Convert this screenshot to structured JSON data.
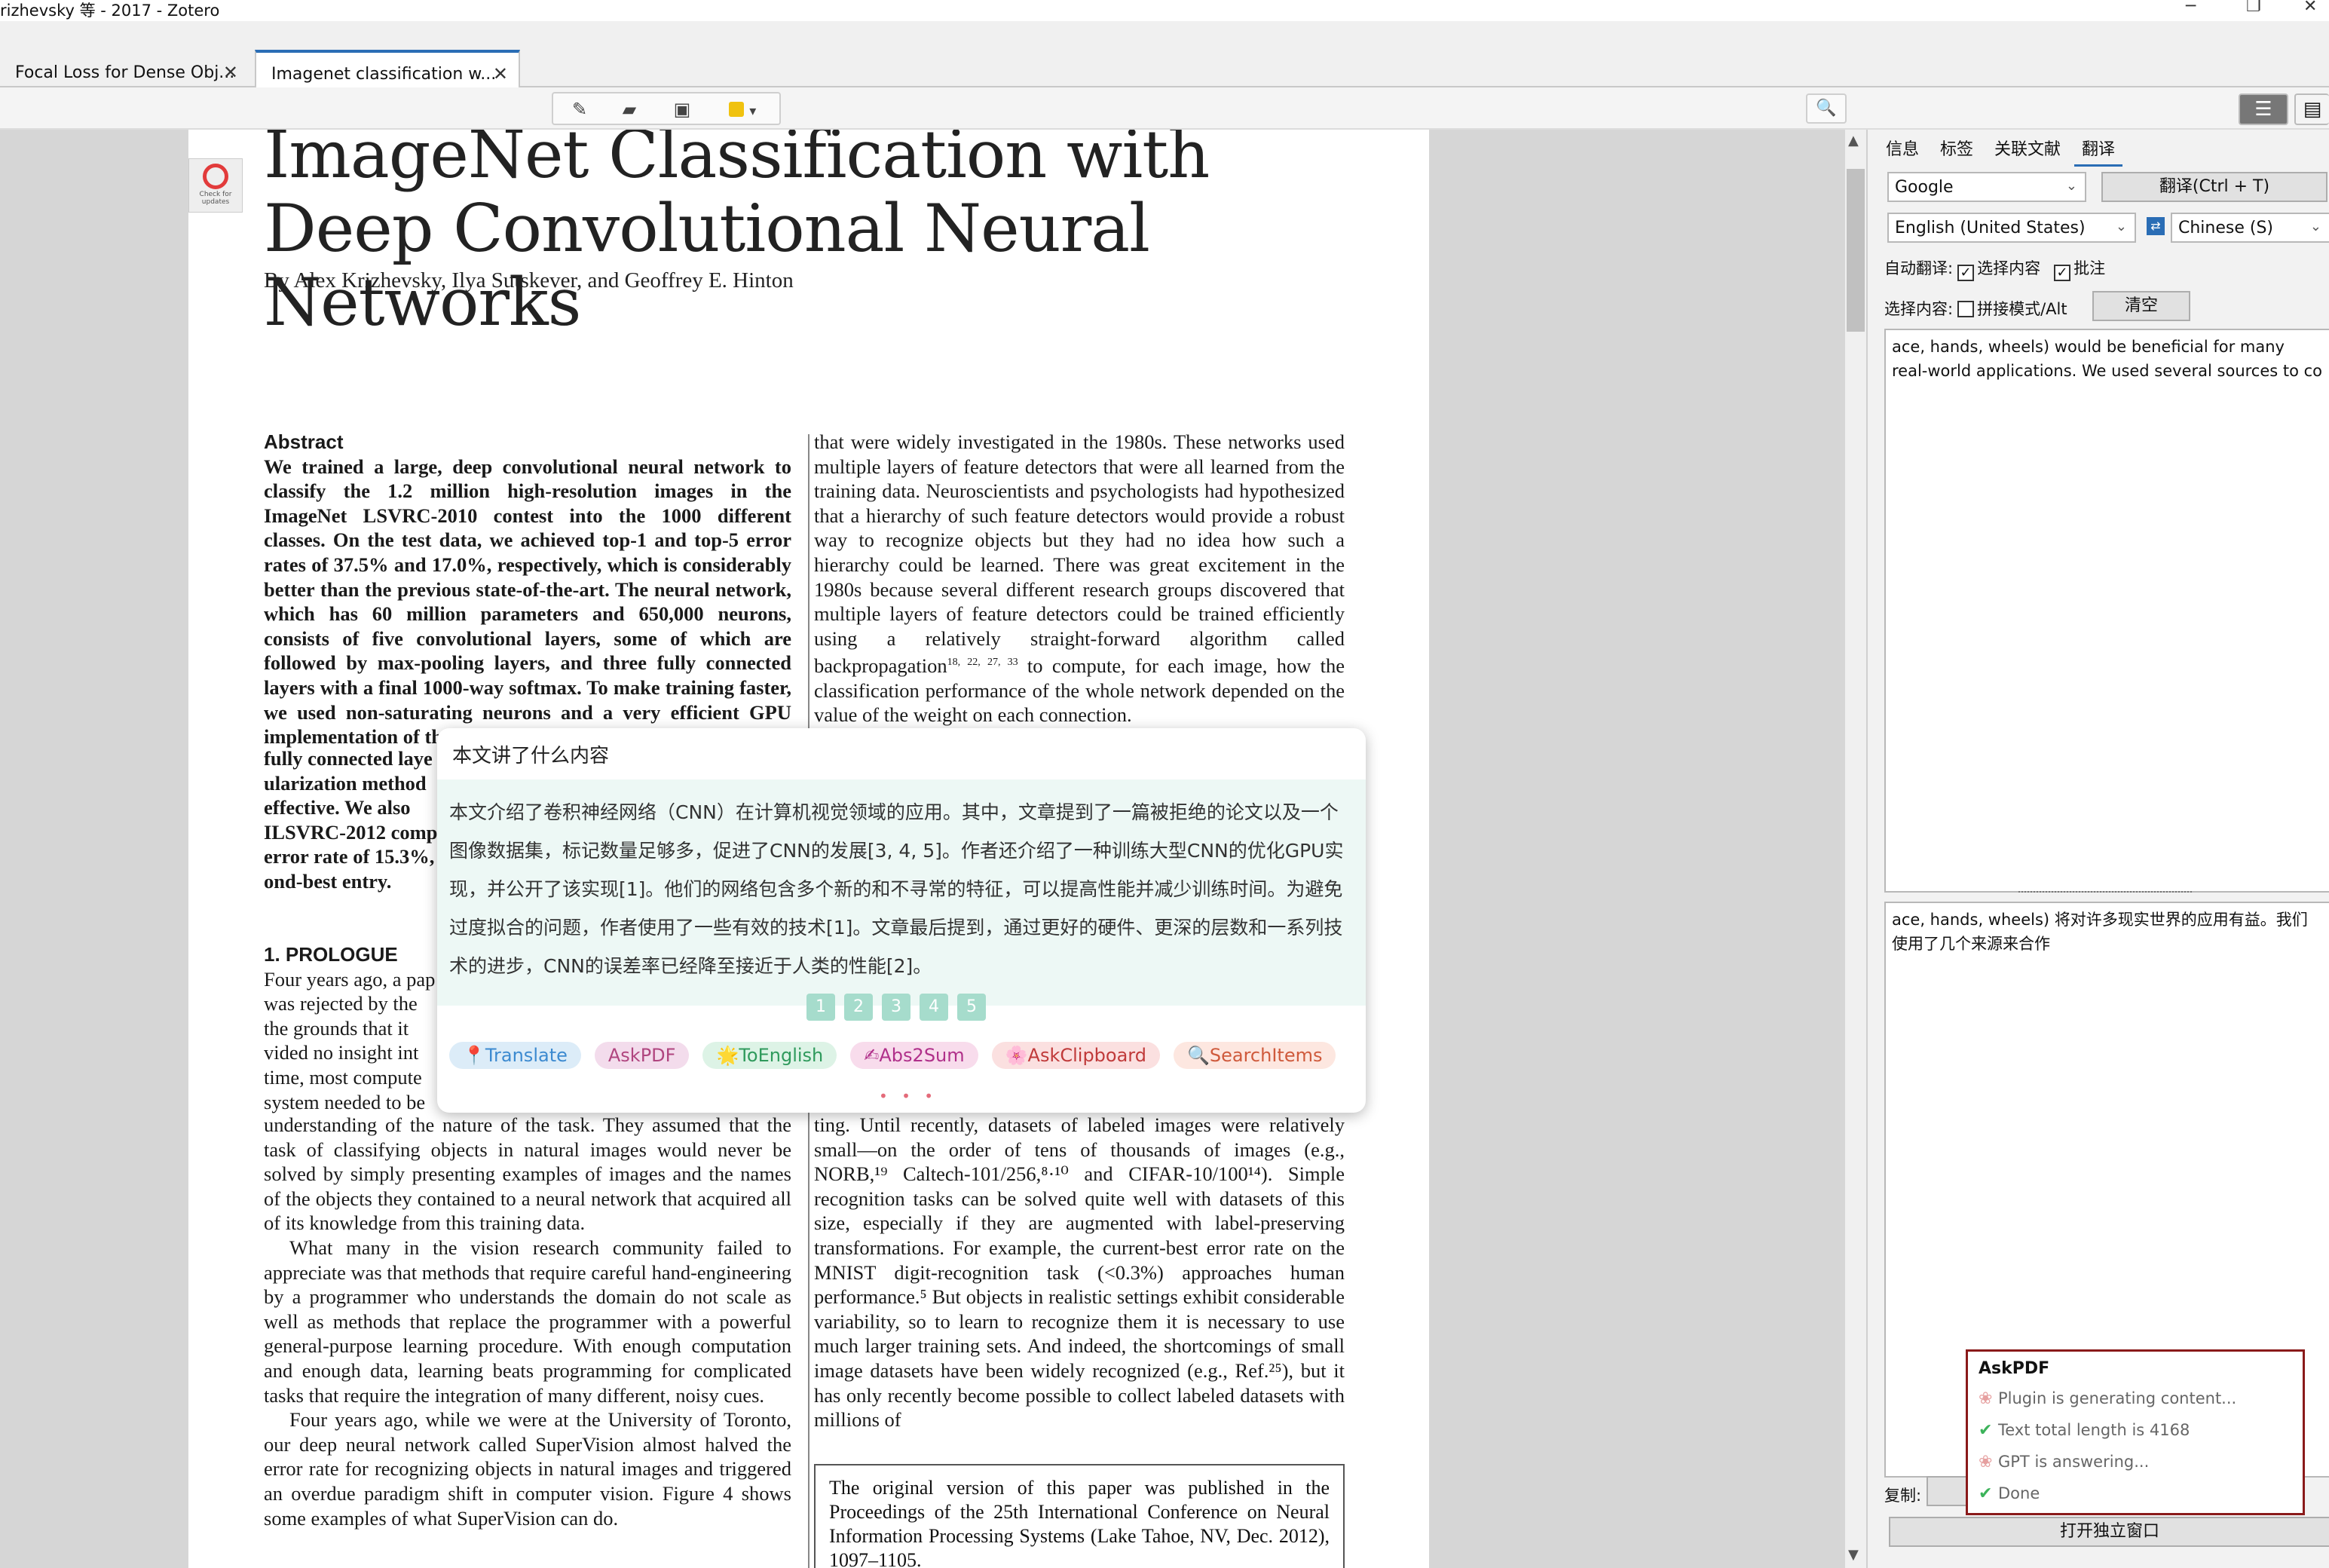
{
  "window": {
    "title": "rizhevsky 等 - 2017 - Zotero",
    "minimize": "─",
    "restore": "❐",
    "close": "✕"
  },
  "tabs": [
    {
      "label": "Focal Loss for Dense Obj...",
      "close": "✕"
    },
    {
      "label": "Imagenet classification w...",
      "close": "✕"
    }
  ],
  "toolbar": {
    "highlight_icon": "pencil-icon",
    "note_icon": "note-icon",
    "area_icon": "area-select-icon",
    "color": "#f0c20f",
    "color_caret": "▾",
    "search": "🔍"
  },
  "paper": {
    "check_updates": "Check for updates",
    "title": "ImageNet Classification with Deep Convolutional Neural Networks",
    "authors": "By Alex Krizhevsky, Ilya Sutskever, and Geoffrey E. Hinton",
    "abstract_head": "Abstract",
    "abstract": "We trained a large, deep convolutional neural network to classify the 1.2 million high-resolution images in the ImageNet LSVRC-2010 contest into the 1000 different classes. On the test data, we achieved top-1 and top-5 error rates of 37.5% and 17.0%, respectively, which is considerably better than the previous state-of-the-art. The neural network, which has 60 million parameters and 650,000 neurons, consists of five convolutional layers, some of which are followed by max-pooling layers, and three fully connected layers with a final 1000-way softmax. To make training faster, we used non-saturating neurons and a very efficient GPU implementation of the convolution",
    "abstract_frag": [
      "fully connected laye",
      "ularization method",
      "effective. We also",
      "ILSVRC-2012 comp",
      "error rate of 15.3%,",
      "ond-best entry."
    ],
    "prologue_head": "1. PROLOGUE",
    "prologue_frag": [
      "Four years ago, a pap",
      "was rejected by the",
      "the grounds that it",
      "vided no insight int",
      "time, most compute",
      "system needed to be"
    ],
    "prologue_p1_rest": "understanding of the nature of the task. They assumed that the task of classifying objects in natural images would never be solved by simply presenting examples of images and the names of the objects they contained to a neural network that acquired all of its knowledge from this training data.",
    "prologue_p2": "What many in the vision research community failed to appreciate was that methods that require careful hand-engineering by a programmer who understands the domain do not scale as well as methods that replace the programmer with a powerful general-purpose learning procedure. With enough computation and enough data, learning beats programming for complicated tasks that require the integration of many different, noisy cues.",
    "prologue_p3": "Four years ago, while we were at the University of Toronto, our deep neural network called SuperVision almost halved the error rate for recognizing objects in natural images and triggered an overdue paradigm shift in computer vision. Figure 4 shows some examples of what SuperVision can do.",
    "right_top": "that were widely investigated in the 1980s. These networks used multiple layers of feature detectors that were all learned from the training data. Neuroscientists and psychologists had hypothesized that a hierarchy of such feature detectors would provide a robust way to recognize objects but they had no idea how such a hierarchy could be learned. There was great excitement in the 1980s because several different research groups discovered that multiple layers of feature detectors could be trained efficiently using a relatively straight-forward algorithm called backpropagation",
    "right_top_sup": "18, 22, 27, 33",
    "right_top_end": " to compute, for each image, how the classification performance of the whole network depended on the value of the weight on each connection.",
    "right_mid": "ting. Until recently, datasets of labeled images were relatively small—on the order of tens of thousands of images (e.g., NORB,¹⁹ Caltech-101/256,⁸·¹⁰ and CIFAR-10/100¹⁴). Simple recognition tasks can be solved quite well with datasets of this size, especially if they are augmented with label-preserving transformations. For example, the current-best error rate on the MNIST digit-recognition task (<0.3%) approaches human performance.⁵ But objects in realistic settings exhibit considerable variability, so to learn to recognize them it is necessary to use much larger training sets. And indeed, the shortcomings of small image datasets have been widely recognized (e.g., Ref.²⁵), but it has only recently become possible to collect labeled datasets with millions of",
    "box_note": "The original version of this paper was published in the Proceedings of the 25th International Conference on Neural Information Processing Systems (Lake Tahoe, NV, Dec. 2012), 1097–1105."
  },
  "popup": {
    "question": "本文讲了什么内容",
    "answer": "本文介绍了卷积神经网络（CNN）在计算机视觉领域的应用。其中，文章提到了一篇被拒绝的论文以及一个图像数据集，标记数量足够多，促进了CNN的发展[3, 4, 5]。作者还介绍了一种训练大型CNN的优化GPU实现，并公开了该实现[1]。他们的网络包含多个新的和不寻常的特征，可以提高性能并减少训练时间。为避免过度拟合的问题，作者使用了一些有效的技术[1]。文章最后提到，通过更好的硬件、更深的层数和一系列技术的进步，CNN的误差率已经降至接近于人类的性能[2]。",
    "pages": [
      "1",
      "2",
      "3",
      "4",
      "5"
    ],
    "tags": [
      {
        "icon": "📍",
        "label": "Translate",
        "bg": "#dcecf8",
        "fg": "#3c8ad0"
      },
      {
        "icon": "",
        "label": "AskPDF",
        "bg": "#f3dcec",
        "fg": "#b0457f"
      },
      {
        "icon": "🌟",
        "label": "ToEnglish",
        "bg": "#ddf3e6",
        "fg": "#2f9a5c"
      },
      {
        "icon": "✍",
        "label": "Abs2Sum",
        "bg": "#f8dcec",
        "fg": "#b0308a"
      },
      {
        "icon": "🌸",
        "label": "AskClipboard",
        "bg": "#fbe0e0",
        "fg": "#c03a3a"
      },
      {
        "icon": "🔍",
        "label": "SearchItems",
        "bg": "#fde7e0",
        "fg": "#cf5a3c"
      }
    ],
    "more": "• • •"
  },
  "sidebar": {
    "tabs": [
      "信息",
      "标签",
      "关联文献",
      "翻译"
    ],
    "engine": "Google",
    "translate_btn": "翻译(Ctrl + T)",
    "source_lang": "English (United States)",
    "swap": "⇄",
    "target_lang": "Chinese (S)",
    "auto_label": "自动翻译:",
    "auto_sel": "选择内容",
    "auto_note": "批注",
    "sel_label": "选择内容:",
    "concat": "拼接模式/Alt",
    "clear_btn": "清空",
    "source_text": "ace, hands, wheels) would be beneficial for many real-world applications. We used several sources to co",
    "target_text": "ace, hands, wheels) 将对许多现实世界的应用有益。我们使用了几个来源来合作",
    "copy_label": "复制:",
    "open_btn": "打开独立窗口",
    "grip": "⋯"
  },
  "toast": {
    "title": "AskPDF",
    "rows": [
      {
        "icon": "gpt-icon",
        "glyph": "❀",
        "text": "Plugin is generating content..."
      },
      {
        "icon": "check-icon",
        "glyph": "✔",
        "text": "Text total length is 4168"
      },
      {
        "icon": "gpt-icon",
        "glyph": "❀",
        "text": "GPT is answering..."
      },
      {
        "icon": "check-icon",
        "glyph": "✔",
        "text": "Done"
      }
    ]
  }
}
